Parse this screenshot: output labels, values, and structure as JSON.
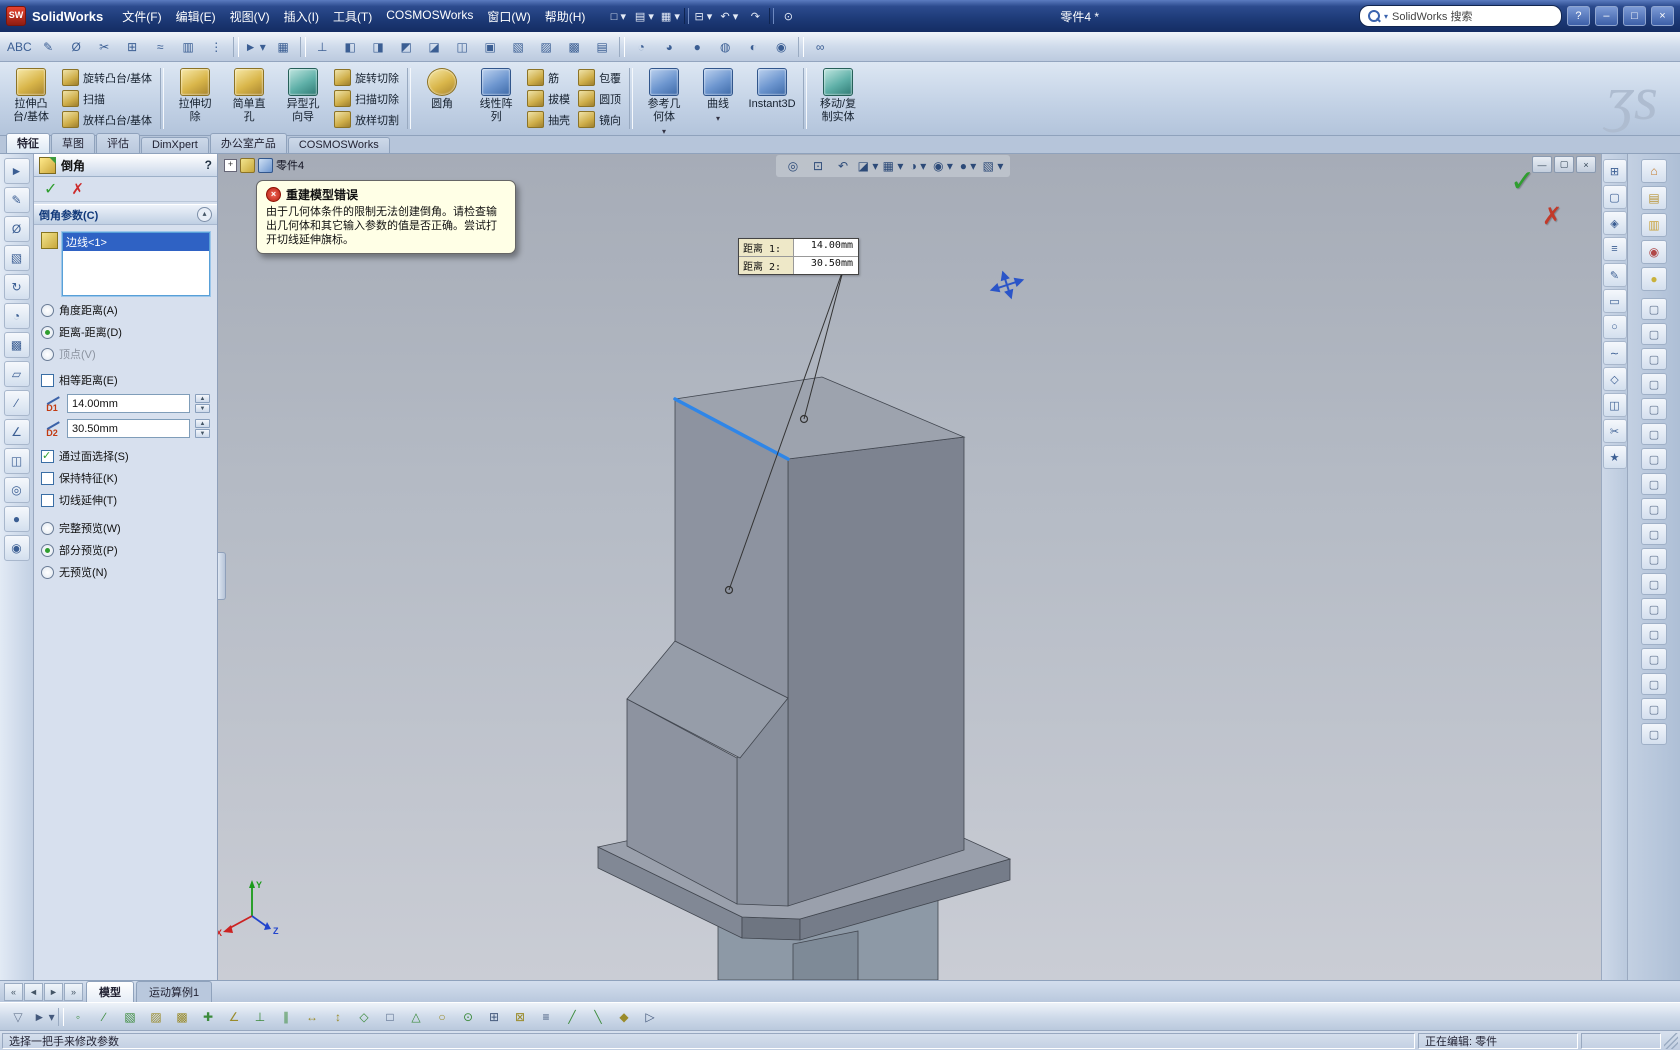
{
  "titlebar": {
    "app_name": "SolidWorks",
    "doc_title": "零件4 *",
    "search_value": "SolidWorks 搜索",
    "help_glyph": "?",
    "min_glyph": "–",
    "max_glyph": "□",
    "close_glyph": "×",
    "menus": [
      "文件(F)",
      "编辑(E)",
      "视图(V)",
      "插入(I)",
      "工具(T)",
      "COSMOSWorks",
      "窗口(W)",
      "帮助(H)"
    ],
    "quick_icons": [
      {
        "name": "new-document-icon",
        "glyph": "□ ▾"
      },
      {
        "name": "open-icon",
        "glyph": "▤ ▾"
      },
      {
        "name": "save-icon",
        "glyph": "▦ ▾"
      },
      {
        "name": "toolbar-separator",
        "glyph": ""
      },
      {
        "name": "print-icon",
        "glyph": "⊟ ▾"
      },
      {
        "name": "undo-icon",
        "glyph": "↶ ▾"
      },
      {
        "name": "redo-icon",
        "glyph": "↷"
      },
      {
        "name": "toolbar-separator",
        "glyph": ""
      },
      {
        "name": "rebuild-icon",
        "glyph": "⊙"
      }
    ]
  },
  "toolbar1": {
    "icons": [
      {
        "name": "spelling-checker-icon",
        "glyph": "ABC"
      },
      {
        "name": "sketch-entities-icon",
        "glyph": "✎"
      },
      {
        "name": "smart-dimension-ic on",
        "glyph": "Ø"
      },
      {
        "name": "trim-entities-icon",
        "glyph": "✂"
      },
      {
        "name": "convert-entities-icon",
        "glyph": "⊞"
      },
      {
        "name": "offset-entities-icon",
        "glyph": "≈"
      },
      {
        "name": "mirror-entities-icon",
        "glyph": "▥"
      },
      {
        "name": "linear-sketch-pattern-icon",
        "glyph": "⋮"
      },
      {
        "name": "toolbar-separator",
        "glyph": ""
      },
      {
        "name": "select-tool-icon",
        "glyph": "► ▾"
      },
      {
        "name": "grid-system-icon",
        "glyph": "▦"
      },
      {
        "name": "toolbar-separator",
        "glyph": ""
      },
      {
        "name": "orientation-anchor-icon",
        "glyph": "⊥"
      },
      {
        "name": "front-view-icon",
        "glyph": "◧"
      },
      {
        "name": "back-view-icon",
        "glyph": "◨"
      },
      {
        "name": "left-view-icon",
        "glyph": "◩"
      },
      {
        "name": "right-view-icon",
        "glyph": "◪"
      },
      {
        "name": "top-view-icon",
        "glyph": "◫"
      },
      {
        "name": "bottom-view-icon",
        "glyph": "▣"
      },
      {
        "name": "isometric-view-icon",
        "glyph": "▧"
      },
      {
        "name": "trimetric-view-icon",
        "glyph": "▨"
      },
      {
        "name": "dimetric-view-icon",
        "glyph": "▩"
      },
      {
        "name": "normal-to-view-icon",
        "glyph": "▤"
      },
      {
        "name": "toolbar-separator",
        "glyph": ""
      },
      {
        "name": "wireframe-icon",
        "glyph": "◔"
      },
      {
        "name": "hidden-lines-icon",
        "glyph": "◕"
      },
      {
        "name": "shaded-icon",
        "glyph": "●"
      },
      {
        "name": "shaded-with-edges-icon",
        "glyph": "◍"
      },
      {
        "name": "shadow-icon",
        "glyph": "◐"
      },
      {
        "name": "perspective-icon",
        "glyph": "◉"
      },
      {
        "name": "toolbar-separator",
        "glyph": ""
      },
      {
        "name": "hyperlink-icon",
        "glyph": "∞"
      }
    ]
  },
  "feature_toolbar": {
    "big": [
      {
        "label": "拉伸凸\n台/基体"
      },
      {
        "label": "拉伸切\n除"
      },
      {
        "label": "简单直\n孔"
      },
      {
        "label": "异型孔\n向导"
      },
      {
        "label": "圆角"
      },
      {
        "label": "线性阵\n列"
      },
      {
        "label": "参考几\n何体"
      },
      {
        "label": "曲线"
      },
      {
        "label": "Instant3D"
      },
      {
        "label": "移动/复\n制实体"
      }
    ],
    "dropdown_glyph": "▾",
    "stacks": [
      [
        "旋转凸台/基体",
        "扫描",
        "放样凸台/基体"
      ],
      [
        "旋转切除",
        "扫描切除",
        "放样切割"
      ],
      [
        "筋",
        "拔模",
        "抽壳"
      ],
      [
        "包覆",
        "圆顶",
        "镜向"
      ]
    ]
  },
  "cm_tabs": [
    {
      "label": "特征",
      "active": "true"
    },
    {
      "label": "草图",
      "active": "false"
    },
    {
      "label": "评估",
      "active": "false"
    },
    {
      "label": "DimXpert",
      "active": "false"
    },
    {
      "label": "办公室产品",
      "active": "false"
    },
    {
      "label": "COSMOSWorks",
      "active": "false"
    }
  ],
  "left_strip": {
    "icons": [
      {
        "name": "select-icon",
        "glyph": "►"
      },
      {
        "name": "sketch-icon",
        "glyph": "✎"
      },
      {
        "name": "dimension-icon",
        "glyph": "Ø"
      },
      {
        "name": "extrude-icon",
        "glyph": "▧"
      },
      {
        "name": "revolve-icon",
        "glyph": "↻"
      },
      {
        "name": "fillet-icon",
        "glyph": "◔"
      },
      {
        "name": "pattern-icon",
        "glyph": "▩"
      },
      {
        "name": "reference-plane-icon",
        "glyph": "▱"
      },
      {
        "name": "axis-icon",
        "glyph": "∕"
      },
      {
        "name": "measure-icon",
        "glyph": "∠"
      },
      {
        "name": "section-icon",
        "glyph": "◫"
      },
      {
        "name": "zoom-icon",
        "glyph": "◎"
      },
      {
        "name": "appearance-icon",
        "glyph": "●"
      },
      {
        "name": "camera-icon",
        "glyph": "◉"
      }
    ]
  },
  "pm": {
    "header": "倒角",
    "help": "?",
    "ok_glyph": "✓",
    "cancel_glyph": "✗",
    "params_title": "倒角参数(C)",
    "collapse_glyph": "▴",
    "selection_item": "边线<1>",
    "opt_angle": "角度距离(A)",
    "opt_dist": "距离-距离(D)",
    "opt_vertex": "顶点(V)",
    "chk_equal": "相等距离(E)",
    "d1_label": "D1",
    "d1_value": "14.00mm",
    "d2_label": "D2",
    "d2_value": "30.50mm",
    "chk_face": "通过面选择(S)",
    "chk_keep": "保持特征(K)",
    "chk_tangent": "切线延伸(T)",
    "opt_full": "完整预览(W)",
    "opt_partial": "部分预览(P)",
    "opt_none": "无预览(N)",
    "states": {
      "opt_angle": false,
      "opt_dist": true,
      "opt_vertex_disabled": true,
      "chk_equal": false,
      "chk_face": true,
      "chk_keep": false,
      "chk_tangent": false,
      "opt_full": false,
      "opt_partial": true,
      "opt_none": false
    }
  },
  "viewport": {
    "tree_label": "零件4",
    "check_glyph": "✓",
    "x_glyph": "✗",
    "window_buttons": {
      "min": "—",
      "restore": "▢",
      "close": "×"
    },
    "callout": {
      "l1": "距离 1:",
      "v1": "14.00mm",
      "l2": "距离 2:",
      "v2": "30.50mm"
    },
    "toolbar_icons": [
      {
        "name": "zoom-fit-icon",
        "glyph": "◎"
      },
      {
        "name": "zoom-area-icon",
        "glyph": "⊡"
      },
      {
        "name": "previous-view-icon",
        "glyph": "↶"
      },
      {
        "name": "section-view-icon",
        "glyph": "◪ ▾"
      },
      {
        "name": "view-orientation-icon",
        "glyph": "▦ ▾"
      },
      {
        "name": "display-style-icon",
        "glyph": "◑ ▾"
      },
      {
        "name": "hide-show-items-icon",
        "glyph": "◉ ▾"
      },
      {
        "name": "edit-appearance-icon",
        "glyph": "● ▾"
      },
      {
        "name": "apply-scene-icon",
        "glyph": "▧ ▾"
      }
    ],
    "triad": {
      "x": "X",
      "y": "Y",
      "z": "Z"
    }
  },
  "error_balloon": {
    "title": "重建模型错误",
    "body": "由于几何体条件的限制无法创建倒角。请检查输出几何体和其它输入参数的值是否正确。尝试打开切线延伸旗标。"
  },
  "right_toolbar": {
    "icons": [
      {
        "name": "full-screen-icon",
        "glyph": "⊞"
      },
      {
        "name": "page-icon",
        "glyph": "▢"
      },
      {
        "name": "compare-icon",
        "glyph": "◈"
      },
      {
        "name": "ruler-icon",
        "glyph": "≡"
      },
      {
        "name": "pencil-icon",
        "glyph": "✎"
      },
      {
        "name": "eraser-icon",
        "glyph": "▭"
      },
      {
        "name": "circle-tool-icon",
        "glyph": "○"
      },
      {
        "name": "spline-icon",
        "glyph": "∼"
      },
      {
        "name": "polygon-icon",
        "glyph": "◇"
      },
      {
        "name": "mirror-icon",
        "glyph": "◫"
      },
      {
        "name": "trim-icon",
        "glyph": "✂"
      },
      {
        "name": "favorites-icon",
        "glyph": "★"
      }
    ]
  },
  "taskpane": {
    "top_icons": [
      {
        "name": "solidworks-resources-icon",
        "glyph": "⌂",
        "color": "#c47a2a"
      },
      {
        "name": "design-library-icon",
        "glyph": "▤",
        "color": "#b89437"
      },
      {
        "name": "file-explorer-icon",
        "glyph": "▥",
        "color": "#c9a23b"
      },
      {
        "name": "palette-icon",
        "glyph": "◉",
        "color": "#b04848"
      },
      {
        "name": "appearances-icon",
        "glyph": "●",
        "color": "#c9b13b"
      }
    ],
    "items": [
      {
        "name": "task-pane-icon",
        "glyph": "▢"
      },
      {
        "name": "task-pane-icon",
        "glyph": "▢"
      },
      {
        "name": "task-pane-icon",
        "glyph": "▢"
      },
      {
        "name": "task-pane-icon",
        "glyph": "▢"
      },
      {
        "name": "task-pane-icon",
        "glyph": "▢"
      },
      {
        "name": "task-pane-icon",
        "glyph": "▢"
      },
      {
        "name": "task-pane-icon",
        "glyph": "▢"
      },
      {
        "name": "task-pane-icon",
        "glyph": "▢"
      },
      {
        "name": "task-pane-icon",
        "glyph": "▢"
      },
      {
        "name": "task-pane-icon",
        "glyph": "▢"
      },
      {
        "name": "task-pane-icon",
        "glyph": "▢"
      },
      {
        "name": "task-pane-icon",
        "glyph": "▢"
      },
      {
        "name": "task-pane-icon",
        "glyph": "▢"
      },
      {
        "name": "task-pane-icon",
        "glyph": "▢"
      },
      {
        "name": "task-pane-icon",
        "glyph": "▢"
      },
      {
        "name": "task-pane-icon",
        "glyph": "▢"
      },
      {
        "name": "task-pane-icon",
        "glyph": "▢"
      },
      {
        "name": "task-pane-icon",
        "glyph": "▢"
      }
    ]
  },
  "bottom_tabs": {
    "nav": [
      "«",
      "◄",
      "►",
      "»"
    ],
    "tabs": [
      {
        "label": "模型",
        "active": "true"
      },
      {
        "label": "运动算例1",
        "active": "false"
      }
    ]
  },
  "bottom_toolbar": {
    "icons": [
      {
        "name": "selection-filter-icon",
        "glyph": "▽",
        "color": "#6b7b94"
      },
      {
        "name": "filter-arrow-icon",
        "glyph": "► ▾",
        "color": "#44597c"
      },
      {
        "name": "toolbar-separator",
        "glyph": ""
      },
      {
        "name": "filter-vertices-icon",
        "glyph": "◦",
        "color": "#3c8b3c"
      },
      {
        "name": "filter-edges-icon",
        "glyph": "∕",
        "color": "#3c8b3c"
      },
      {
        "name": "filter-faces-icon",
        "glyph": "▧",
        "color": "#3c8b3c"
      },
      {
        "name": "filter-surface-bodies-icon",
        "glyph": "▨",
        "color": "#9a8b2a"
      },
      {
        "name": "filter-solid-bodies-icon",
        "glyph": "▩",
        "color": "#9a8b2a"
      },
      {
        "name": "filter-frame-icon",
        "glyph": "✚",
        "color": "#3c8b3c"
      },
      {
        "name": "filter-angle-icon",
        "glyph": "∠",
        "color": "#9a8b2a"
      },
      {
        "name": "filter-perpendicular-icon",
        "glyph": "⊥",
        "color": "#3c8b3c"
      },
      {
        "name": "filter-parallel-icon",
        "glyph": "∥",
        "color": "#3c8b3c"
      },
      {
        "name": "filter-horizontal-icon",
        "glyph": "↔",
        "color": "#9a8b2a"
      },
      {
        "name": "filter-vertical-icon",
        "glyph": "↕",
        "color": "#9a8b2a"
      },
      {
        "name": "filter-midpoint-icon",
        "glyph": "◇",
        "color": "#3c8b3c"
      },
      {
        "name": "filter-plane-icon",
        "glyph": "□",
        "color": "#44597c"
      },
      {
        "name": "filter-triangle-icon",
        "glyph": "△",
        "color": "#3c8b3c"
      },
      {
        "name": "filter-circle-icon",
        "glyph": "○",
        "color": "#9a8b2a"
      },
      {
        "name": "filter-point-icon",
        "glyph": "⊙",
        "color": "#3c8b3c"
      },
      {
        "name": "filter-grid-icon",
        "glyph": "⊞",
        "color": "#44597c"
      },
      {
        "name": "filter-cross-icon",
        "glyph": "⊠",
        "color": "#9a8b2a"
      },
      {
        "name": "filter-lines-icon",
        "glyph": "≡",
        "color": "#44597c"
      },
      {
        "name": "filter-diagonal-icon",
        "glyph": "╱",
        "color": "#3c8b3c"
      },
      {
        "name": "filter-backslash-icon",
        "glyph": "╲",
        "color": "#3c8b3c"
      },
      {
        "name": "filter-diamond-icon",
        "glyph": "◆",
        "color": "#9a8b2a"
      },
      {
        "name": "filter-run-icon",
        "glyph": "▷",
        "color": "#44597c"
      }
    ]
  },
  "status_bar": {
    "left": "选择一把手来修改参数",
    "right": "正在编辑: 零件"
  }
}
